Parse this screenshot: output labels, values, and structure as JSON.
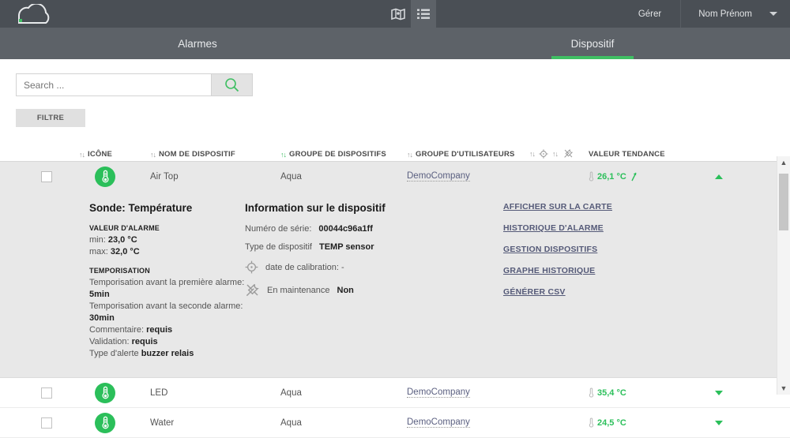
{
  "topbar": {
    "logo": "cloud-logo",
    "map_icon": "map-icon",
    "list_icon": "list-icon",
    "manage_label": "Gérer",
    "user_label": "Nom Prénom"
  },
  "tabs": [
    {
      "label": "Alarmes",
      "active": false
    },
    {
      "label": "Dispositif",
      "active": true
    }
  ],
  "toolbar": {
    "search_placeholder": "Search ...",
    "search_value": "",
    "search_icon": "search-icon",
    "filter_label": "FILTRE"
  },
  "table": {
    "headers": {
      "icon": "ICÔNE",
      "device_name": "NOM DE DISPOSITIF",
      "device_group": "GROUPE DE DISPOSITIFS",
      "user_group": "GROUPE D'UTILISATEURS",
      "calibration_icon": "calibration-target-icon",
      "maintenance_icon": "maintenance-tools-icon",
      "trend_value": "VALEUR TENDANCE"
    },
    "sort_glyph": "↑↓",
    "active_sort_column": "device_group",
    "rows": [
      {
        "name": "Air Top",
        "device_group": "Aqua",
        "user_group": "DemoCompany",
        "value": "26,1 °C",
        "trend": "up",
        "expanded": true,
        "sensor_icon": "thermometer-icon"
      },
      {
        "name": "LED",
        "device_group": "Aqua",
        "user_group": "DemoCompany",
        "value": "35,4 °C",
        "trend": "none",
        "expanded": false,
        "sensor_icon": "thermometer-icon"
      },
      {
        "name": "Water",
        "device_group": "Aqua",
        "user_group": "DemoCompany",
        "value": "24,5 °C",
        "trend": "none",
        "expanded": false,
        "sensor_icon": "thermometer-icon"
      }
    ]
  },
  "detail": {
    "probe_title": "Sonde: Température",
    "alarm_heading": "VALEUR D'ALARME",
    "alarm_min_label": "min:",
    "alarm_min_value": "23,0 °C",
    "alarm_max_label": "max:",
    "alarm_max_value": "32,0 °C",
    "delay_heading": "TEMPORISATION",
    "delay_first_label": "Temporisation avant la première alarme:",
    "delay_first_value": "5min",
    "delay_second_label": "Temporisation avant la seconde alarme:",
    "delay_second_value": "30min",
    "comment_label": "Commentaire:",
    "comment_value": "requis",
    "validation_label": "Validation:",
    "validation_value": "requis",
    "alert_type_label": "Type d'alerte",
    "alert_type_value": "buzzer relais",
    "info_title": "Information sur le dispositif",
    "serial_label": "Numéro de série:",
    "serial_value": "00044c96a1ff",
    "device_type_label": "Type de dispositif",
    "device_type_value": "TEMP sensor",
    "calibration_label": "date de calibration: -",
    "maintenance_label": "En maintenance",
    "maintenance_value": "Non",
    "actions": [
      "AFFICHER SUR LA CARTE",
      "HISTORIQUE D'ALARME",
      "GESTION DISPOSITIFS",
      "GRAPHE HISTORIQUE",
      "GÉNÉRER CSV"
    ]
  },
  "colors": {
    "accent_green": "#3fbf63",
    "topbar": "#4a4f55",
    "tabbar": "#5d6268"
  }
}
